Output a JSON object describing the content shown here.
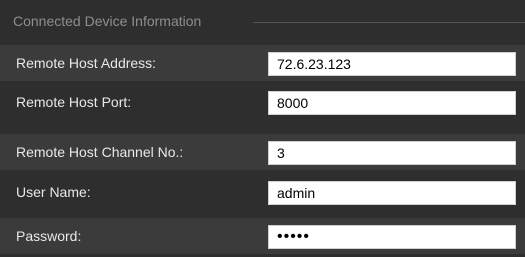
{
  "group": {
    "title": "Connected Device Information"
  },
  "fields": [
    {
      "label": "Remote Host Address:",
      "value": "72.6.23.123"
    },
    {
      "label": "Remote Host Port:",
      "value": "8000"
    },
    {
      "label": "Remote Host Channel No.:",
      "value": "3"
    },
    {
      "label": "User Name:",
      "value": "admin"
    },
    {
      "label": "Password:",
      "value": "•••••"
    }
  ],
  "colors": {
    "background": "#2e2e2e",
    "alt_row": "#3b3b3b",
    "label_text": "#e8e8e8",
    "group_title": "#8e8e8e",
    "field_background": "#ffffff"
  }
}
